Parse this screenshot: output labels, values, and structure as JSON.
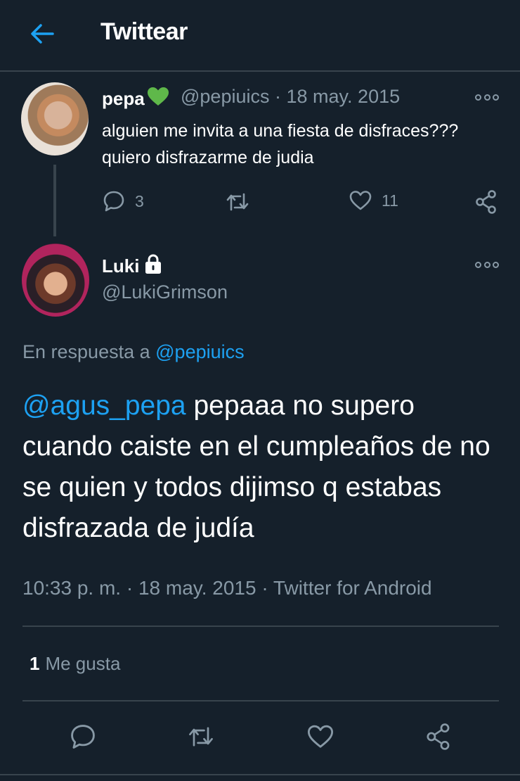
{
  "header": {
    "title": "Twittear"
  },
  "parent_tweet": {
    "name": "pepa",
    "name_emoji": "green-heart",
    "handle": "@pepiuics",
    "separator": "·",
    "date": "18 may. 2015",
    "text": "alguien me invita a una fiesta de disfraces??? quiero disfrazarme de judia",
    "replies": "3",
    "retweets": "",
    "likes": "11"
  },
  "tweet": {
    "name": "Luki",
    "handle": "@LukiGrimson",
    "reply_prefix": "En respuesta a",
    "reply_to": "@pepiuics",
    "mention": "@agus_pepa",
    "text": " pepaaa no supero cuando caiste en el cumpleaños de no se quien y todos dijimso q estabas disfrazada de judía",
    "timestamp": "10:33 p. m. · 18 may. 2015 · Twitter for Android",
    "like_count": "1",
    "like_label": "Me gusta"
  },
  "colors": {
    "background": "#15202b",
    "accent": "#1da1f2",
    "secondary_text": "#8899a6",
    "divider": "#38444d",
    "emoji_heart": "#5fb84a"
  }
}
